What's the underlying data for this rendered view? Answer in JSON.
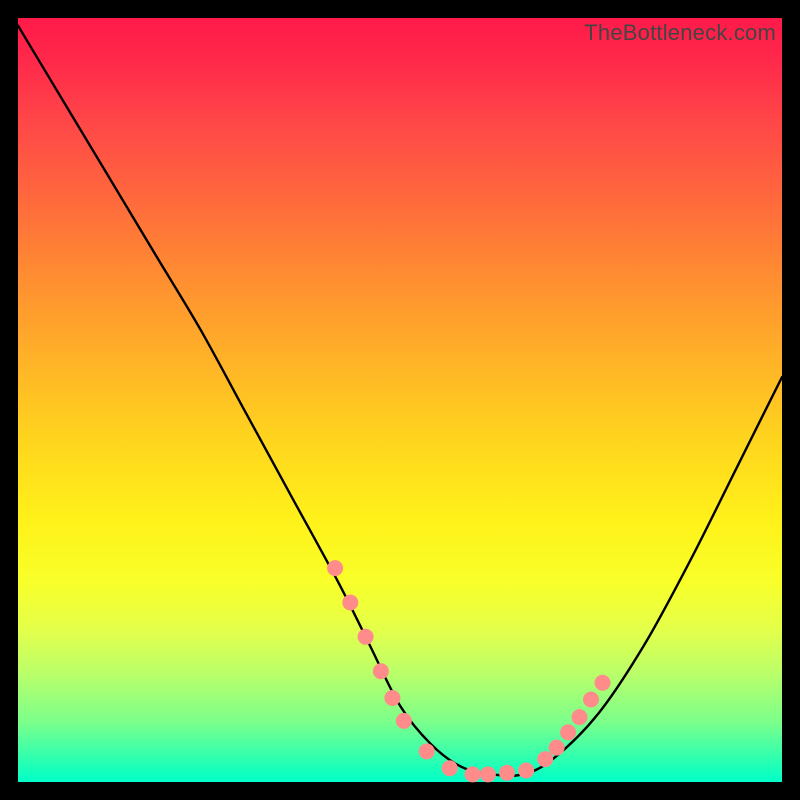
{
  "watermark": "TheBottleneck.com",
  "chart_data": {
    "type": "line",
    "title": "",
    "xlabel": "",
    "ylabel": "",
    "xlim": [
      0,
      100
    ],
    "ylim": [
      0,
      100
    ],
    "grid": false,
    "series": [
      {
        "name": "bottleneck-curve",
        "x": [
          0,
          6,
          12,
          18,
          24,
          30,
          36,
          42,
          46,
          50,
          54,
          58,
          62,
          66,
          70,
          76,
          82,
          88,
          94,
          100
        ],
        "values": [
          99,
          89,
          79,
          69,
          59,
          48,
          37,
          26,
          18,
          10,
          5,
          2,
          1,
          1,
          3,
          9,
          18,
          29,
          41,
          53
        ]
      }
    ],
    "markers": {
      "name": "highlight-dots",
      "color": "#ff8b8b",
      "radius": 8,
      "x": [
        41.5,
        43.5,
        45.5,
        47.5,
        49.0,
        50.5,
        53.5,
        56.5,
        59.5,
        61.5,
        64.0,
        66.5,
        69.0,
        70.5,
        72.0,
        73.5,
        75.0,
        76.5
      ],
      "values": [
        28.0,
        23.5,
        19.0,
        14.5,
        11.0,
        8.0,
        4.0,
        1.8,
        1.0,
        1.0,
        1.2,
        1.5,
        3.0,
        4.5,
        6.5,
        8.5,
        10.8,
        13.0
      ]
    },
    "background_gradient": {
      "top": "#ff1a4a",
      "bottom": "#00ffc8"
    }
  }
}
